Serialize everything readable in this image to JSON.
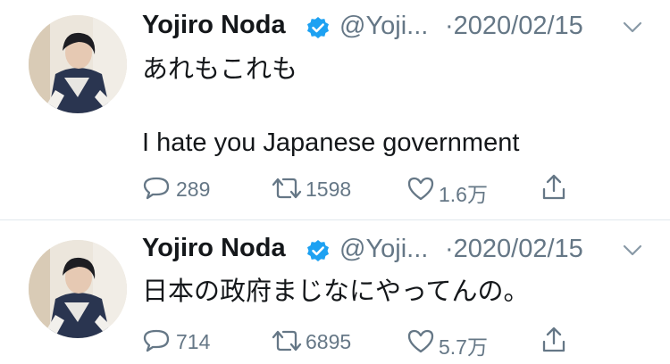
{
  "tweets": [
    {
      "author": {
        "name": "Yojiro Noda",
        "handle": "@Yoji...",
        "verified": true
      },
      "date": "·2020/02/15",
      "text_lines": [
        "あれもこれも",
        "I hate you Japanese government"
      ],
      "stats": {
        "replies": "289",
        "retweets": "1598",
        "likes": "1.6万"
      }
    },
    {
      "author": {
        "name": "Yojiro Noda",
        "handle": "@Yoji...",
        "verified": true
      },
      "date": "·2020/02/15",
      "text_lines": [
        "日本の政府まじなにやってんの。"
      ],
      "stats": {
        "replies": "714",
        "retweets": "6895",
        "likes": "5.7万"
      }
    }
  ],
  "colors": {
    "text": "#14171a",
    "secondary": "#657786",
    "verified": "#1da1f2",
    "divider": "#e1e8ed"
  },
  "icons": [
    "reply-icon",
    "retweet-icon",
    "like-icon",
    "share-icon",
    "verified-badge-icon",
    "chevron-down-icon"
  ]
}
